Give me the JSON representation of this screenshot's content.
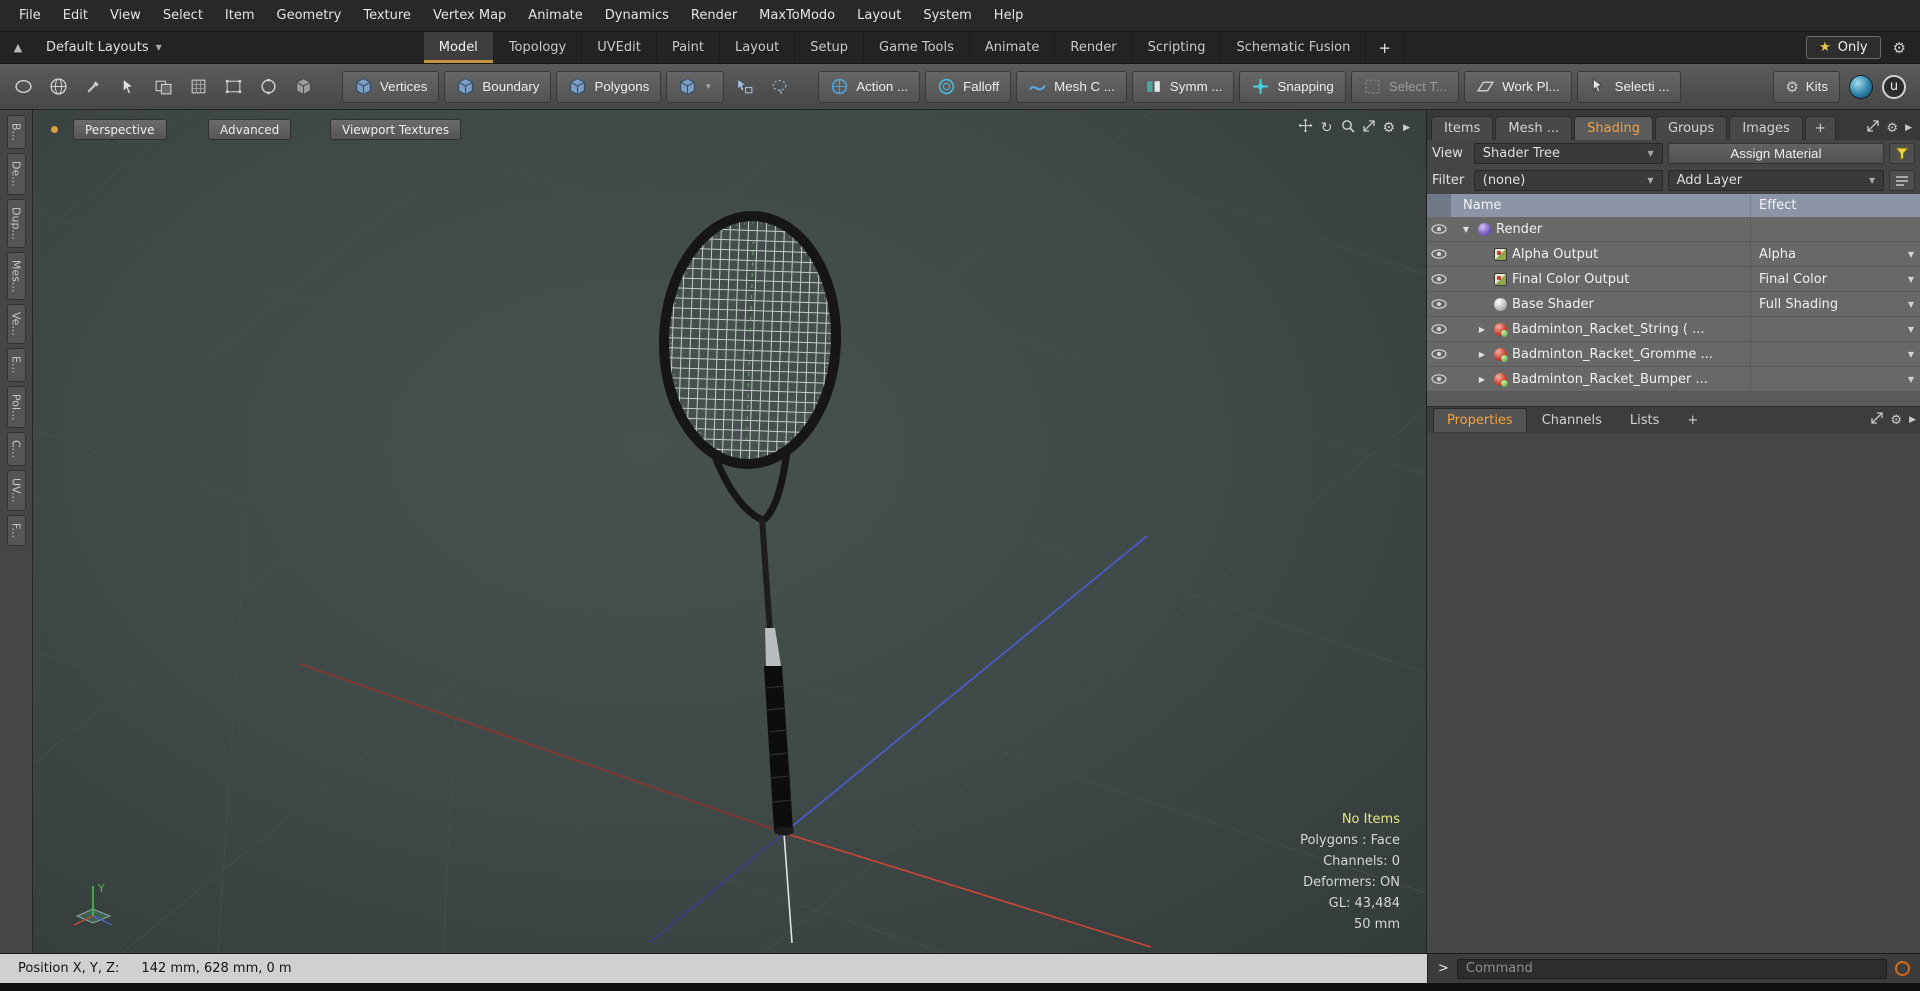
{
  "menubar": {
    "items": [
      "File",
      "Edit",
      "View",
      "Select",
      "Item",
      "Geometry",
      "Texture",
      "Vertex Map",
      "Animate",
      "Dynamics",
      "Render",
      "MaxToModo",
      "Layout",
      "System",
      "Help"
    ]
  },
  "layout_bar": {
    "layouts_label": "Default Layouts",
    "tabs": [
      "Model",
      "Topology",
      "UVEdit",
      "Paint",
      "Layout",
      "Setup",
      "Game Tools",
      "Animate",
      "Render",
      "Scripting",
      "Schematic Fusion"
    ],
    "active_tab": "Model",
    "add_label": "+",
    "only_label": "Only"
  },
  "toolbar": {
    "vertices_label": "Vertices",
    "boundary_label": "Boundary",
    "polygons_label": "Polygons",
    "action_label": "Action  ...",
    "falloff_label": "Falloff",
    "mesh_label": "Mesh C ...",
    "symmetry_label": "Symm ...",
    "snapping_label": "Snapping",
    "select_through_label": "Select T...",
    "work_plane_label": "Work Pl...",
    "selection_label": "Selecti ...",
    "kits_label": "Kits"
  },
  "left_strip": {
    "tabs": [
      "B...",
      "De...",
      "Dup...",
      "Mes...",
      "Ve...",
      "E...",
      "Pol...",
      "C...",
      "UV...",
      "F..."
    ]
  },
  "viewport": {
    "perspective_label": "Perspective",
    "advanced_label": "Advanced",
    "textures_label": "Viewport Textures",
    "gizmo_y": "Y",
    "status": {
      "no_items": "No Items",
      "polygons": "Polygons : Face",
      "channels": "Channels: 0",
      "deformers": "Deformers: ON",
      "gl": "GL: 43,484",
      "grid": "50 mm"
    }
  },
  "right_panel": {
    "tabs": [
      "Items",
      "Mesh ...",
      "Shading",
      "Groups",
      "Images"
    ],
    "active_tab": "Shading",
    "add_label": "+",
    "view_label": "View",
    "view_value": "Shader Tree",
    "assign_material_label": "Assign Material",
    "filter_label": "Filter",
    "filter_value": "(none)",
    "add_layer_label": "Add Layer",
    "columns": {
      "name": "Name",
      "effect": "Effect"
    },
    "tree": [
      {
        "name": "Render",
        "effect": "",
        "icon": "render-sphere",
        "expanded": true
      },
      {
        "name": "Alpha Output",
        "effect": "Alpha",
        "icon": "render-output"
      },
      {
        "name": "Final Color Output",
        "effect": "Final Color",
        "icon": "render-output"
      },
      {
        "name": "Base Shader",
        "effect": "Full Shading",
        "icon": "shader-sphere"
      },
      {
        "name": "Badminton_Racket_String (  ...",
        "effect": "",
        "icon": "material-sphere"
      },
      {
        "name": "Badminton_Racket_Gromme ...",
        "effect": "",
        "icon": "material-sphere"
      },
      {
        "name": "Badminton_Racket_Bumper  ...",
        "effect": "",
        "icon": "material-sphere"
      }
    ],
    "lower_tabs": [
      "Properties",
      "Channels",
      "Lists"
    ],
    "lower_active_tab": "Properties",
    "lower_add_label": "+"
  },
  "bottom_bar": {
    "position_label": "Position X, Y, Z:",
    "position_value": "142 mm, 628 mm, 0 m",
    "command_prompt": ">",
    "command_placeholder": "Command"
  },
  "icons": {
    "caret_down": "▼",
    "collapsed": "▶",
    "star": "★",
    "gear": "⚙",
    "rotate": "↻",
    "side_arrow": "▶",
    "up_arrow": "▲",
    "plus": "+",
    "modo_logo": "u"
  },
  "colors": {
    "accent_orange": "#f0a23c",
    "tab_underline": "#c59445",
    "status_yellow": "#e6e67e",
    "axis_x_red": "#cf4436",
    "axis_y_green": "#46c24a",
    "axis_z_blue": "#4b5cd6",
    "tree_header": "#8b95a5"
  }
}
